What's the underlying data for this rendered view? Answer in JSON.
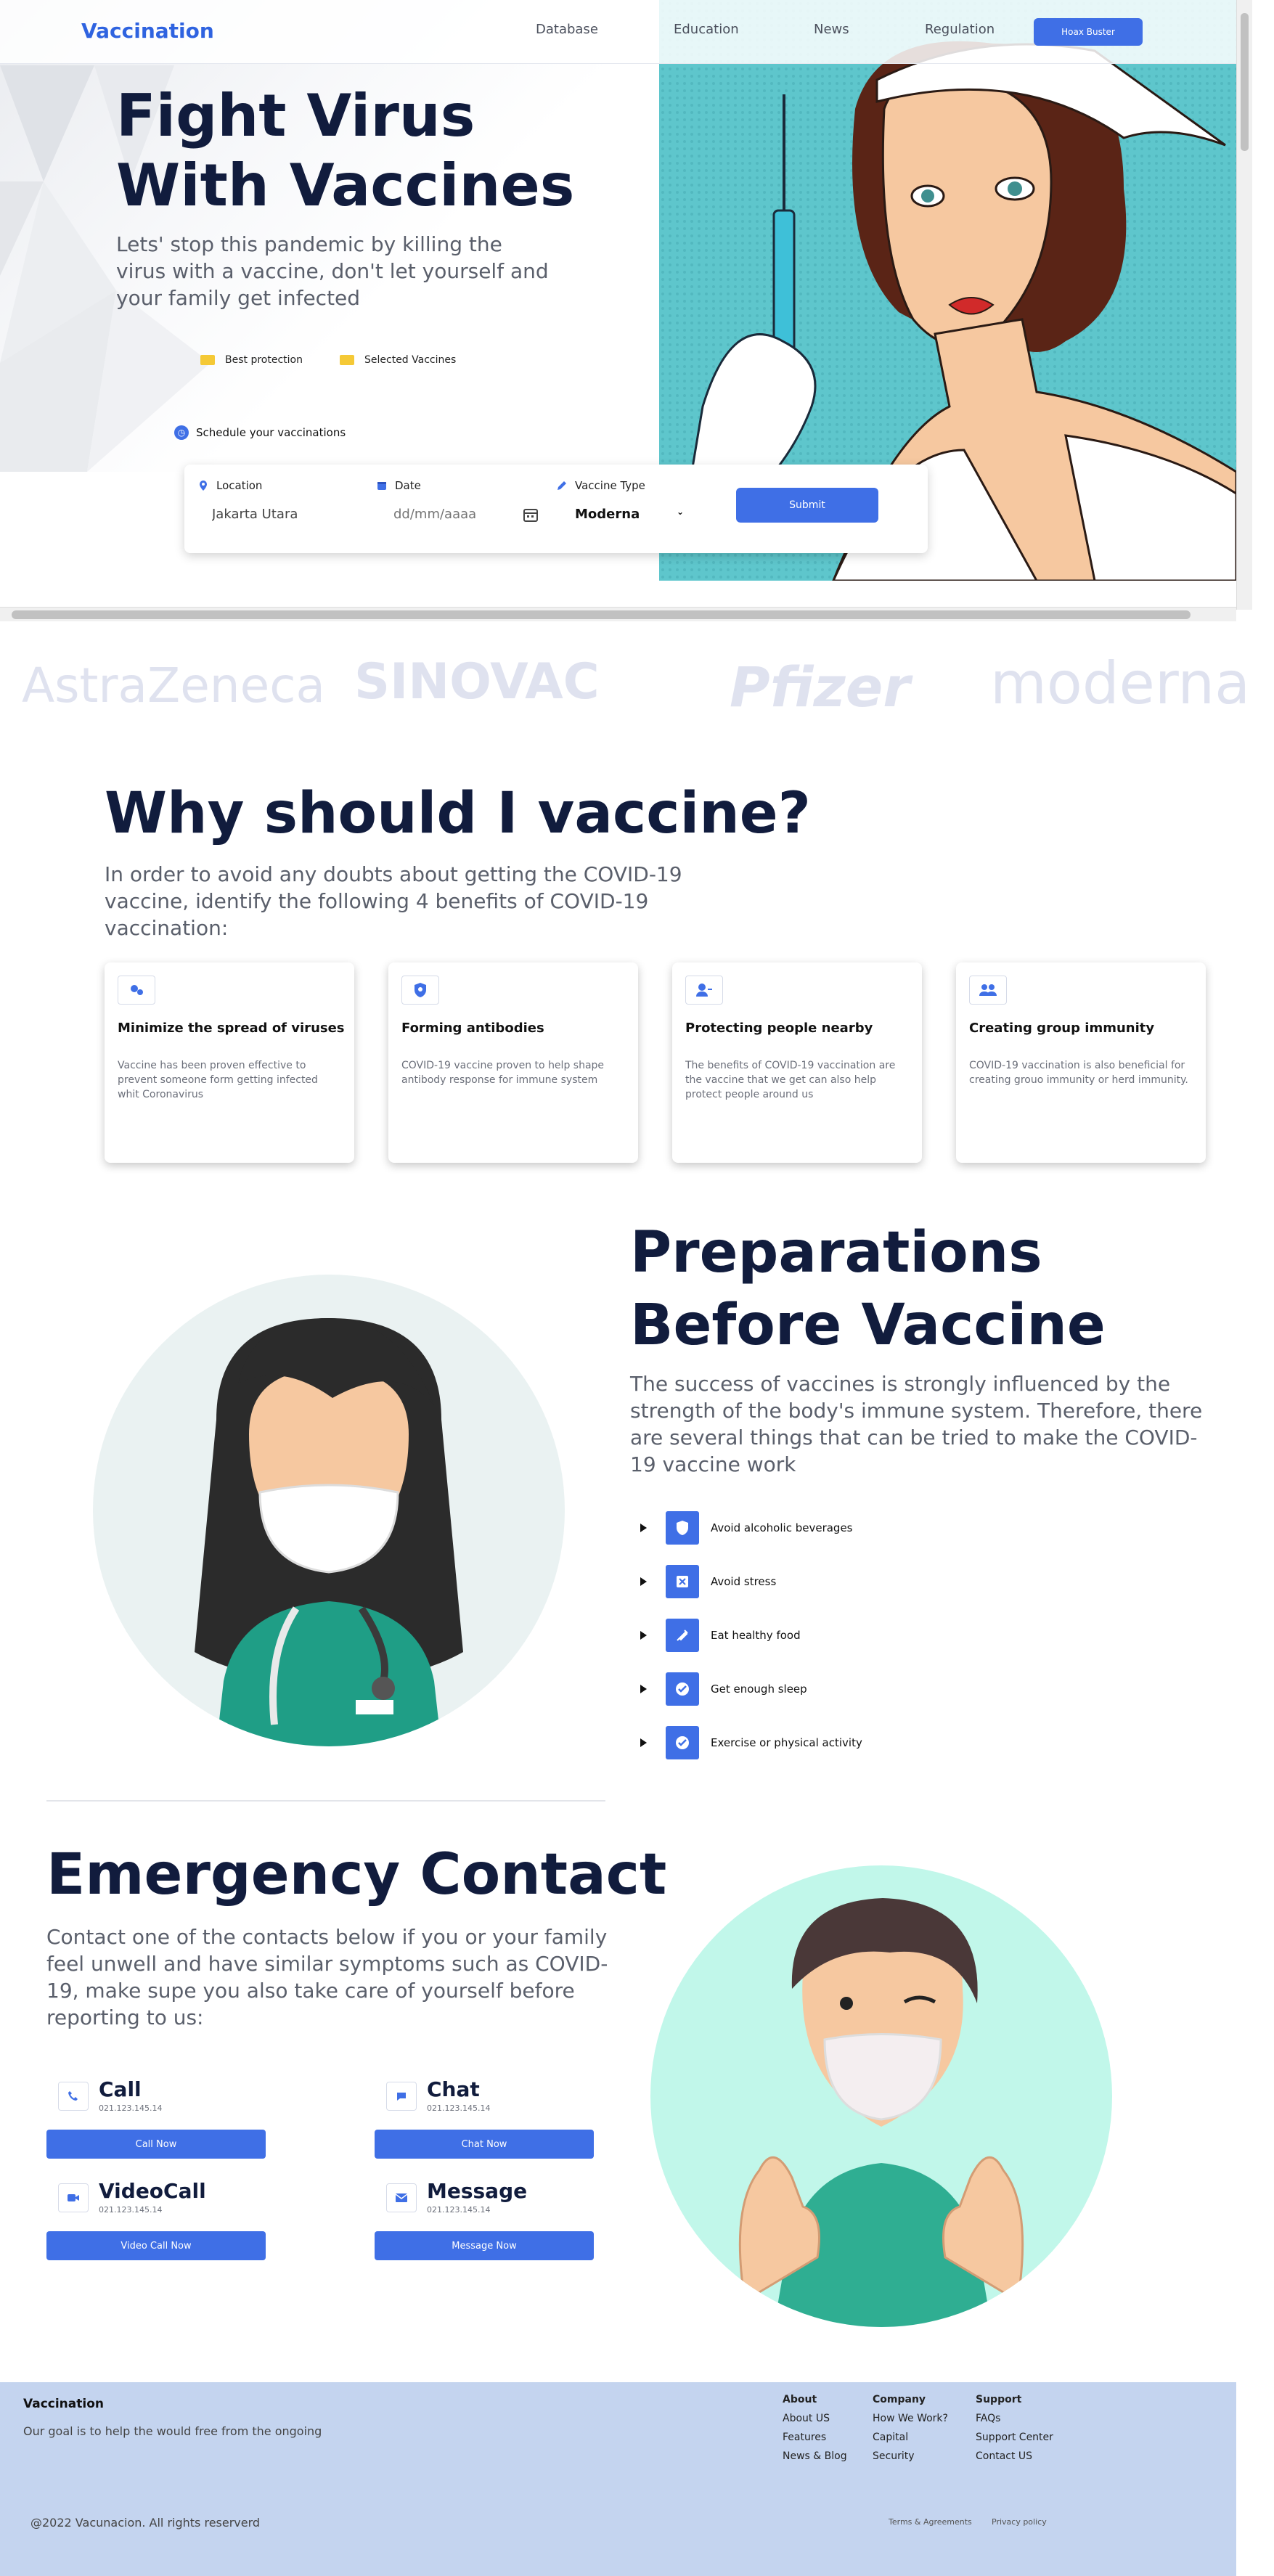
{
  "nav": {
    "brand": "Vaccination",
    "links": [
      "Database",
      "Education",
      "News",
      "Regulation"
    ],
    "cta": "Hoax Buster"
  },
  "hero": {
    "title": "Fight Virus With Vaccines",
    "subtitle": "Lets' stop this pandemic by killing the virus with a vaccine, don't let yourself and your family get infected",
    "badges": [
      "Best protection",
      "Selected Vaccines"
    ],
    "schedule_label": "Schedule your vaccinations",
    "form": {
      "location_label": "Location",
      "location_value": "Jakarta Utara",
      "date_label": "Date",
      "date_placeholder": "dd/mm/aaaa",
      "type_label": "Vaccine Type",
      "type_value": "Moderna",
      "submit": "Submit"
    }
  },
  "brands": [
    "AstraZeneca",
    "SINOVAC",
    "Pfizer",
    "moderna"
  ],
  "why": {
    "title": "Why should I vaccine?",
    "subtitle": "In order to avoid any doubts about getting the COVID-19 vaccine, identify the following 4 benefits of COVID-19 vaccination:",
    "cards": [
      {
        "icon": "virus-icon",
        "title": "Minimize the spread of viruses",
        "desc": "Vaccine has been proven effective to prevent someone form getting infected whit Coronavirus"
      },
      {
        "icon": "shield-icon",
        "title": "Forming antibodies",
        "desc": "COVID-19 vaccine proven to help shape antibody response for immune system"
      },
      {
        "icon": "user-icon",
        "title": "Protecting people nearby",
        "desc": "The benefits of COVID-19 vaccination are the vaccine that we get can also help protect people around us"
      },
      {
        "icon": "group-icon",
        "title": "Creating group immunity",
        "desc": "COVID-19 vaccination is also beneficial for creating grouo immunity or herd immunity."
      }
    ]
  },
  "prep": {
    "title": "Preparations Before Vaccine",
    "subtitle": "The success of vaccines is strongly influenced by the strength of the body's immune system. Therefore, there are several things that can be tried to make the COVID-19 vaccine work",
    "items": [
      {
        "icon": "shield-icon",
        "label": "Avoid alcoholic beverages"
      },
      {
        "icon": "close-box-icon",
        "label": "Avoid stress"
      },
      {
        "icon": "syringe-icon",
        "label": "Eat healthy food"
      },
      {
        "icon": "check-circle-icon",
        "label": "Get enough sleep"
      },
      {
        "icon": "check-circle-icon",
        "label": "Exercise or physical activity"
      }
    ]
  },
  "emergency": {
    "title": "Emergency Contact",
    "subtitle": "Contact one of the contacts below if you or your family feel unwell and have similar symptoms such as COVID-19, make supe you also take care of yourself before reporting to us:",
    "contacts": [
      {
        "icon": "phone-icon",
        "name": "Call",
        "number": "021.123.145.14",
        "button": "Call Now"
      },
      {
        "icon": "chat-icon",
        "name": "Chat",
        "number": "021.123.145.14",
        "button": "Chat Now"
      },
      {
        "icon": "video-icon",
        "name": "VideoCall",
        "number": "021.123.145.14",
        "button": "Video Call Now"
      },
      {
        "icon": "mail-icon",
        "name": "Message",
        "number": "021.123.145.14",
        "button": "Message Now"
      }
    ]
  },
  "footer": {
    "brand": "Vaccination",
    "tagline": "Our goal is to help the would free from the ongoing",
    "columns": [
      {
        "heading": "About",
        "links": [
          "About US",
          "Features",
          "News & Blog"
        ]
      },
      {
        "heading": "Company",
        "links": [
          "How We Work?",
          "Capital",
          "Security"
        ]
      },
      {
        "heading": "Support",
        "links": [
          "FAQs",
          "Support Center",
          "Contact US"
        ]
      }
    ],
    "copyright": "@2022 Vacunacion. All rights reserverd",
    "terms": "Terms & Agreements",
    "privacy": "Privacy policy"
  },
  "colors": {
    "accent": "#3f6fe6",
    "heading": "#111c3d",
    "footer_bg": "#c4d4ef",
    "badge": "#f5c936"
  }
}
